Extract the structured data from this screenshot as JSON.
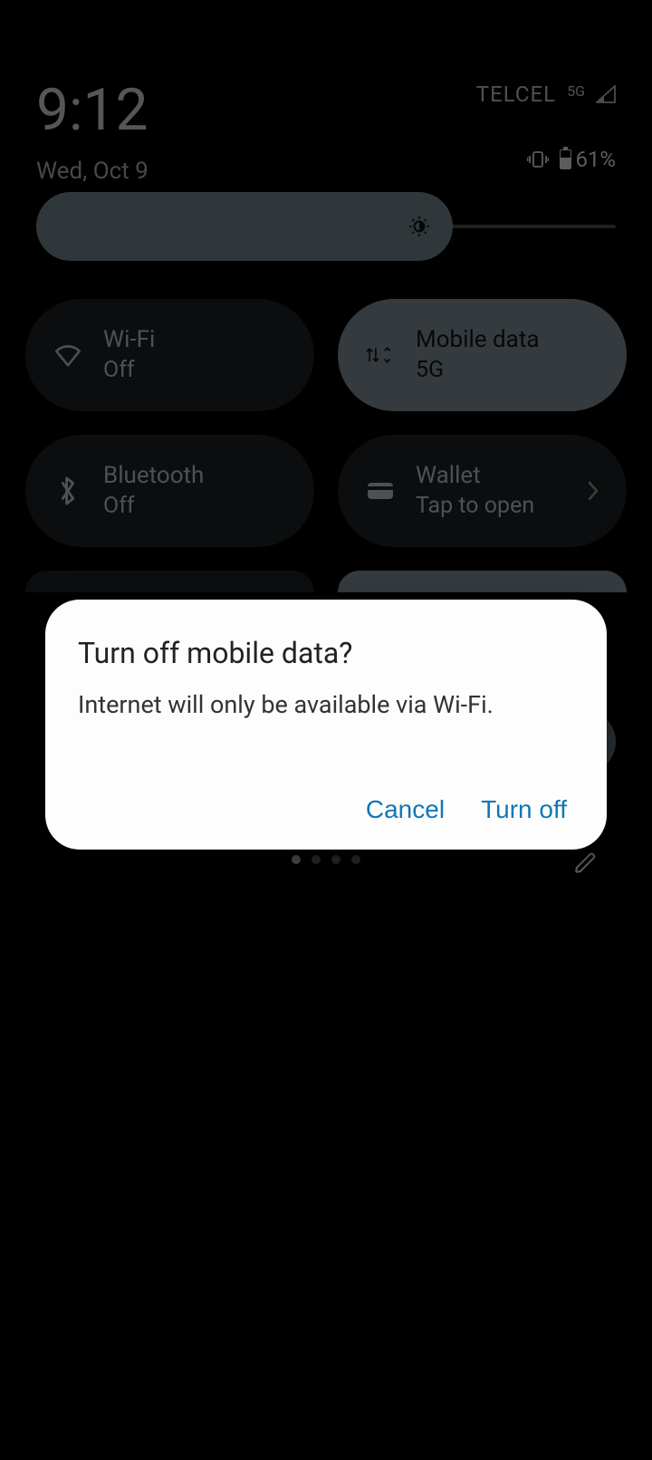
{
  "status": {
    "time": "9:12",
    "date": "Wed, Oct 9",
    "carrier": "TELCEL",
    "network_badge": "5G",
    "battery_percent": "61%"
  },
  "tiles": {
    "wifi": {
      "title": "Wi-Fi",
      "sub": "Off"
    },
    "mobile": {
      "title": "Mobile data",
      "sub": "5G"
    },
    "bluetooth": {
      "title": "Bluetooth",
      "sub": "Off"
    },
    "wallet": {
      "title": "Wallet",
      "sub": "Tap to open"
    }
  },
  "dialog": {
    "title": "Turn off mobile data?",
    "message": "Internet will only be available via Wi-Fi.",
    "cancel": "Cancel",
    "confirm": "Turn off"
  }
}
